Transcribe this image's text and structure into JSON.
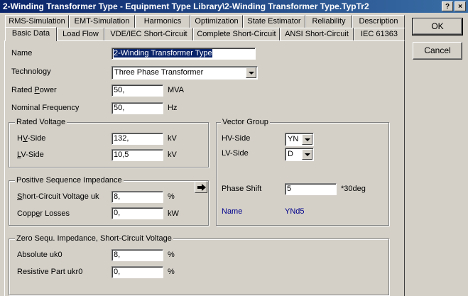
{
  "window": {
    "title": "2-Winding Transformer Type - Equipment Type Library\\2-Winding Transformer Type.TypTr2",
    "help_label": "?",
    "close_label": "×"
  },
  "tabs_row1": [
    "RMS-Simulation",
    "EMT-Simulation",
    "Harmonics",
    "Optimization",
    "State Estimator",
    "Reliability",
    "Description"
  ],
  "tabs_row2": [
    "Basic Data",
    "Load Flow",
    "VDE/IEC Short-Circuit",
    "Complete Short-Circuit",
    "ANSI Short-Circuit",
    "IEC 61363"
  ],
  "buttons": {
    "ok": "OK",
    "cancel": "Cancel"
  },
  "fields": {
    "name_label": "Name",
    "name_value": "2-Winding Transformer Type",
    "technology_label": "Technology",
    "technology_value": "Three Phase Transformer",
    "rated_power_label_pre": "Rated ",
    "rated_power_label_u": "P",
    "rated_power_label_post": "ower",
    "rated_power_value": "50,",
    "rated_power_unit": "MVA",
    "nominal_freq_label": "Nominal Frequency",
    "nominal_freq_value": "50,",
    "nominal_freq_unit": "Hz"
  },
  "rated_voltage": {
    "title": "Rated Voltage",
    "hv_label_pre": "H",
    "hv_label_u": "V",
    "hv_label_post": "-Side",
    "hv_value": "132,",
    "hv_unit": "kV",
    "lv_label_pre": "",
    "lv_label_u": "L",
    "lv_label_post": "V-Side",
    "lv_value": "10,5",
    "lv_unit": "kV"
  },
  "positive_seq": {
    "title": "Positive Sequence Impedance",
    "uk_label_u": "S",
    "uk_label_post": "hort-Circuit Voltage uk",
    "uk_value": "8,",
    "uk_unit": "%",
    "cu_label_pre": "Copp",
    "cu_label_u": "e",
    "cu_label_post": "r Losses",
    "cu_value": "0,",
    "cu_unit": "kW"
  },
  "vector_group": {
    "title": "Vector Group",
    "hv_label": "HV-Side",
    "hv_value": "YN",
    "lv_label": "LV-Side",
    "lv_value": "D",
    "phase_shift_label": "Phase Shift",
    "phase_shift_value": "5",
    "phase_shift_unit": "*30deg",
    "name_label": "Name",
    "name_value": "YNd5"
  },
  "zero_seq": {
    "title": "Zero Sequ. Impedance, Short-Circuit Voltage",
    "uk0_label": "Absolute uk0",
    "uk0_value": "8,",
    "uk0_unit": "%",
    "ukr0_label": "Resistive Part ukr0",
    "ukr0_value": "0,",
    "ukr0_unit": "%"
  },
  "colors": {
    "title_bar": "#0a246a",
    "face": "#d4d0c8",
    "vector_name": "#00008b"
  }
}
